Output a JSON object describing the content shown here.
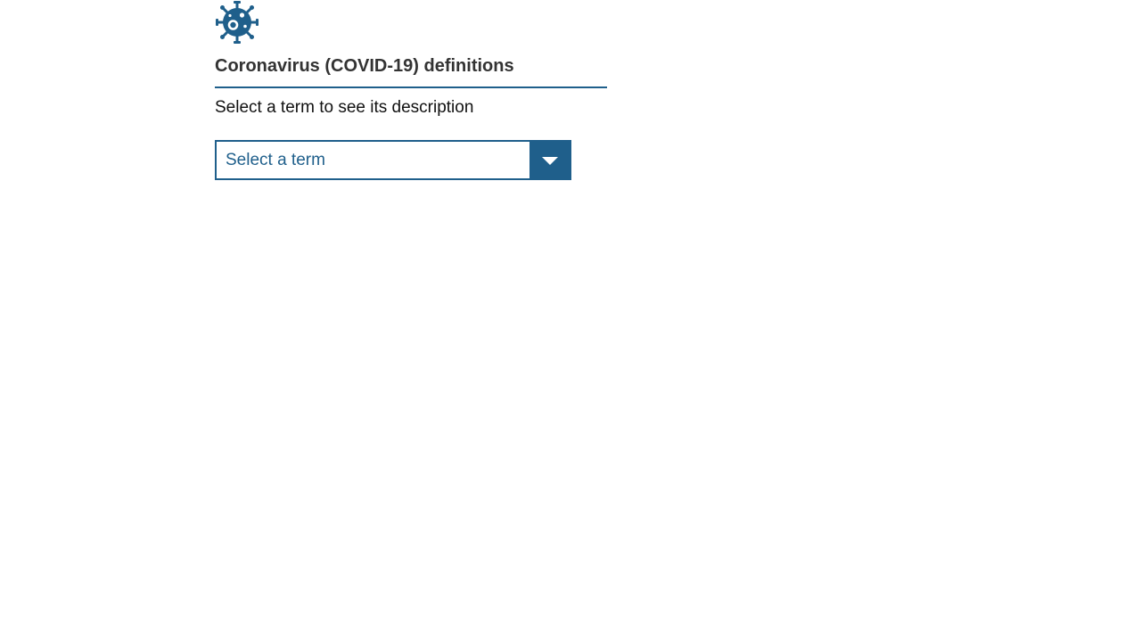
{
  "icon": "virus-icon",
  "title": "Coronavirus (COVID-19) definitions",
  "instruction": "Select a term to see its description",
  "term_select": {
    "value": "Select a term",
    "arrow_icon": "chevron-down-icon"
  },
  "colors": {
    "accent": "#1f5f8b",
    "title": "#333333",
    "text": "#111111",
    "background": "#ffffff"
  }
}
